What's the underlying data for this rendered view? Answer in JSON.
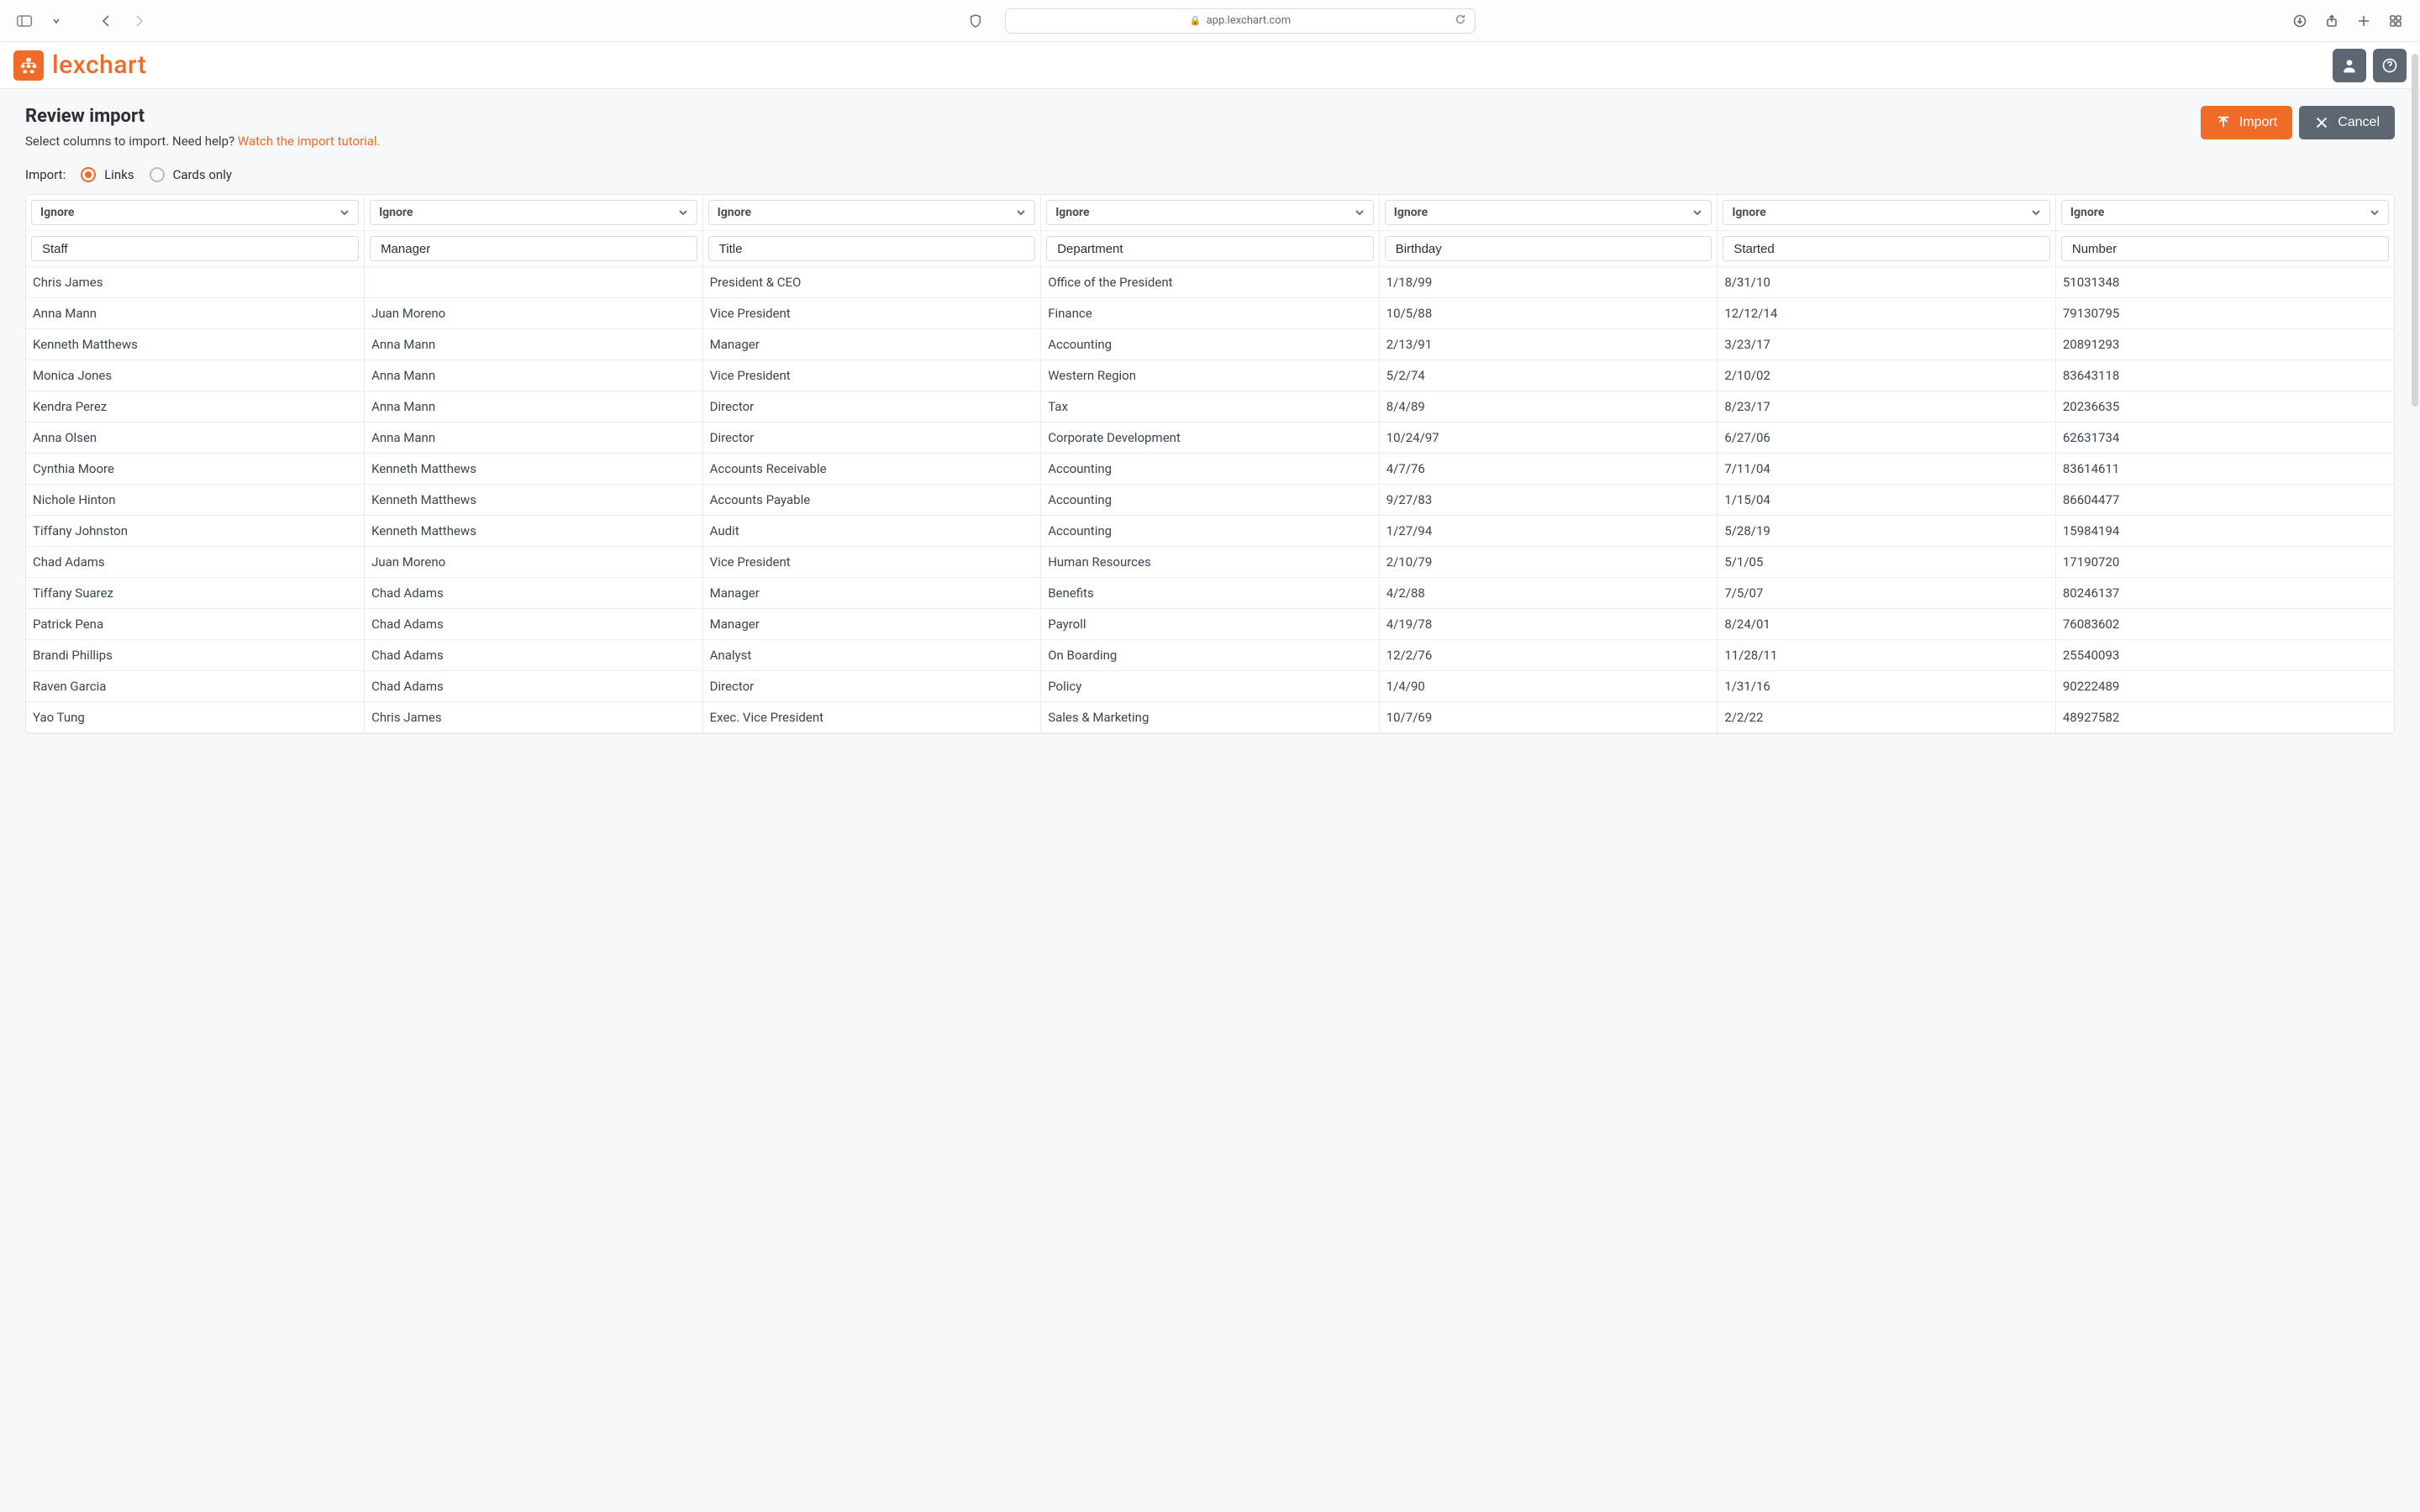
{
  "browser": {
    "url_host": "app.lexchart.com"
  },
  "app": {
    "brand": "lexchart"
  },
  "page": {
    "title": "Review import",
    "help_prefix": "Select columns to import. Need help? ",
    "help_link_text": "Watch the import tutorial.",
    "actions": {
      "import": "Import",
      "cancel": "Cancel"
    },
    "import_mode": {
      "label": "Import:",
      "option_links": "Links",
      "option_cards": "Cards only",
      "selected": "links"
    }
  },
  "table": {
    "column_select_value": "Ignore",
    "columns": [
      {
        "header": "Staff"
      },
      {
        "header": "Manager"
      },
      {
        "header": "Title"
      },
      {
        "header": "Department"
      },
      {
        "header": "Birthday"
      },
      {
        "header": "Started"
      },
      {
        "header": "Number"
      }
    ],
    "rows": [
      [
        "Chris James",
        "",
        "President & CEO",
        "Office of the President",
        "1/18/99",
        "8/31/10",
        "51031348"
      ],
      [
        "Anna Mann",
        "Juan Moreno",
        "Vice President",
        "Finance",
        "10/5/88",
        "12/12/14",
        "79130795"
      ],
      [
        "Kenneth Matthews",
        "Anna Mann",
        "Manager",
        "Accounting",
        "2/13/91",
        "3/23/17",
        "20891293"
      ],
      [
        "Monica Jones",
        "Anna Mann",
        "Vice President",
        "Western Region",
        "5/2/74",
        "2/10/02",
        "83643118"
      ],
      [
        "Kendra Perez",
        "Anna Mann",
        "Director",
        "Tax",
        "8/4/89",
        "8/23/17",
        "20236635"
      ],
      [
        "Anna Olsen",
        "Anna Mann",
        "Director",
        "Corporate Development",
        "10/24/97",
        "6/27/06",
        "62631734"
      ],
      [
        "Cynthia Moore",
        "Kenneth Matthews",
        "Accounts Receivable",
        "Accounting",
        "4/7/76",
        "7/11/04",
        "83614611"
      ],
      [
        "Nichole Hinton",
        "Kenneth Matthews",
        "Accounts Payable",
        "Accounting",
        "9/27/83",
        "1/15/04",
        "86604477"
      ],
      [
        "Tiffany Johnston",
        "Kenneth Matthews",
        "Audit",
        "Accounting",
        "1/27/94",
        "5/28/19",
        "15984194"
      ],
      [
        "Chad Adams",
        "Juan Moreno",
        "Vice President",
        "Human Resources",
        "2/10/79",
        "5/1/05",
        "17190720"
      ],
      [
        "Tiffany Suarez",
        "Chad Adams",
        "Manager",
        "Benefits",
        "4/2/88",
        "7/5/07",
        "80246137"
      ],
      [
        "Patrick Pena",
        "Chad Adams",
        "Manager",
        "Payroll",
        "4/19/78",
        "8/24/01",
        "76083602"
      ],
      [
        "Brandi Phillips",
        "Chad Adams",
        "Analyst",
        "On Boarding",
        "12/2/76",
        "11/28/11",
        "25540093"
      ],
      [
        "Raven Garcia",
        "Chad Adams",
        "Director",
        "Policy",
        "1/4/90",
        "1/31/16",
        "90222489"
      ],
      [
        "Yao Tung",
        "Chris James",
        "Exec. Vice President",
        "Sales & Marketing",
        "10/7/69",
        "2/2/22",
        "48927582"
      ]
    ]
  }
}
